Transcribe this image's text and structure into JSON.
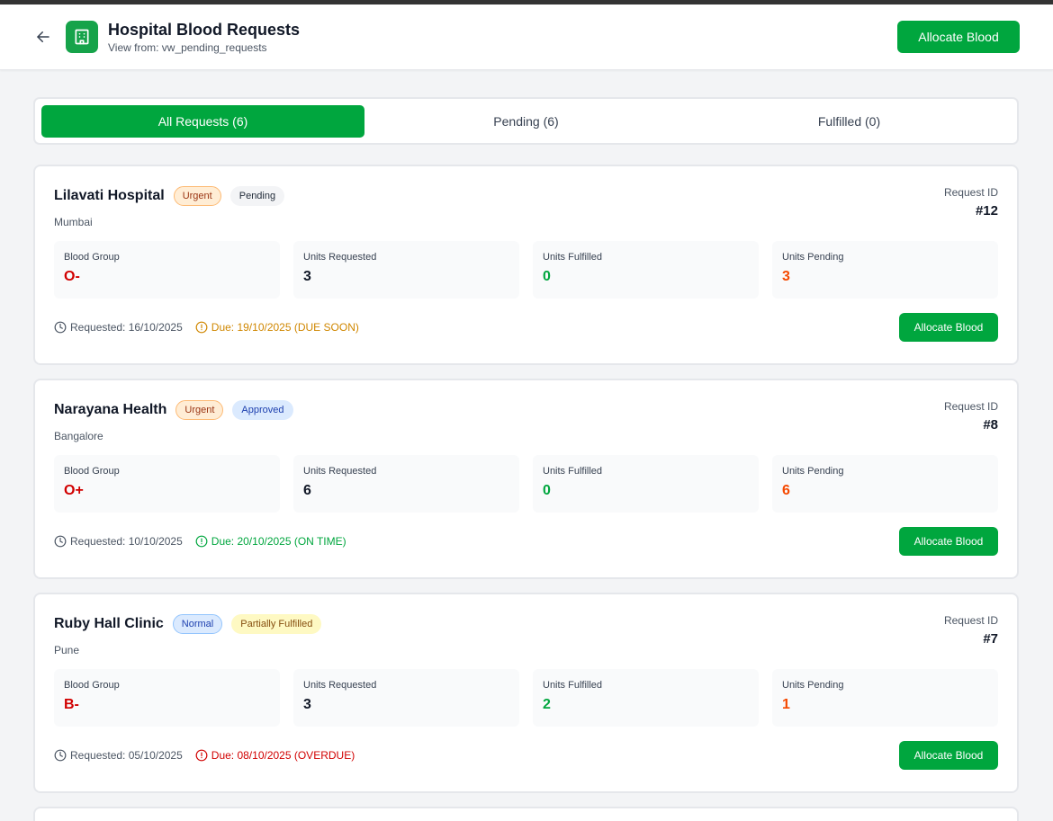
{
  "header": {
    "title": "Hospital Blood Requests",
    "subtitle": "View from: vw_pending_requests",
    "allocate_label": "Allocate Blood"
  },
  "tabs": [
    {
      "label": "All Requests (6)",
      "active": true
    },
    {
      "label": "Pending (6)",
      "active": false
    },
    {
      "label": "Fulfilled (0)",
      "active": false
    }
  ],
  "labels": {
    "request_id": "Request ID",
    "blood_group": "Blood Group",
    "units_requested": "Units Requested",
    "units_fulfilled": "Units Fulfilled",
    "units_pending": "Units Pending",
    "allocate": "Allocate Blood"
  },
  "requests": [
    {
      "hospital": "Lilavati Hospital",
      "priority": "Urgent",
      "status": "Pending",
      "city": "Mumbai",
      "id": "#12",
      "blood_group": "O-",
      "units_requested": "3",
      "units_fulfilled": "0",
      "units_pending": "3",
      "requested": "Requested: 16/10/2025",
      "due": "Due: 19/10/2025 (DUE SOON)"
    },
    {
      "hospital": "Narayana Health",
      "priority": "Urgent",
      "status": "Approved",
      "city": "Bangalore",
      "id": "#8",
      "blood_group": "O+",
      "units_requested": "6",
      "units_fulfilled": "0",
      "units_pending": "6",
      "requested": "Requested: 10/10/2025",
      "due": "Due: 20/10/2025 (ON TIME)"
    },
    {
      "hospital": "Ruby Hall Clinic",
      "priority": "Normal",
      "status": "Partially Fulfilled",
      "city": "Pune",
      "id": "#7",
      "blood_group": "B-",
      "units_requested": "3",
      "units_fulfilled": "2",
      "units_pending": "1",
      "requested": "Requested: 05/10/2025",
      "due": "Due: 08/10/2025 (OVERDUE)"
    }
  ],
  "colors": {
    "primary": "#00a63e",
    "blood_group": "#d10000",
    "pending": "#f54900",
    "due_soon": "#d08700",
    "overdue": "#d10000"
  }
}
